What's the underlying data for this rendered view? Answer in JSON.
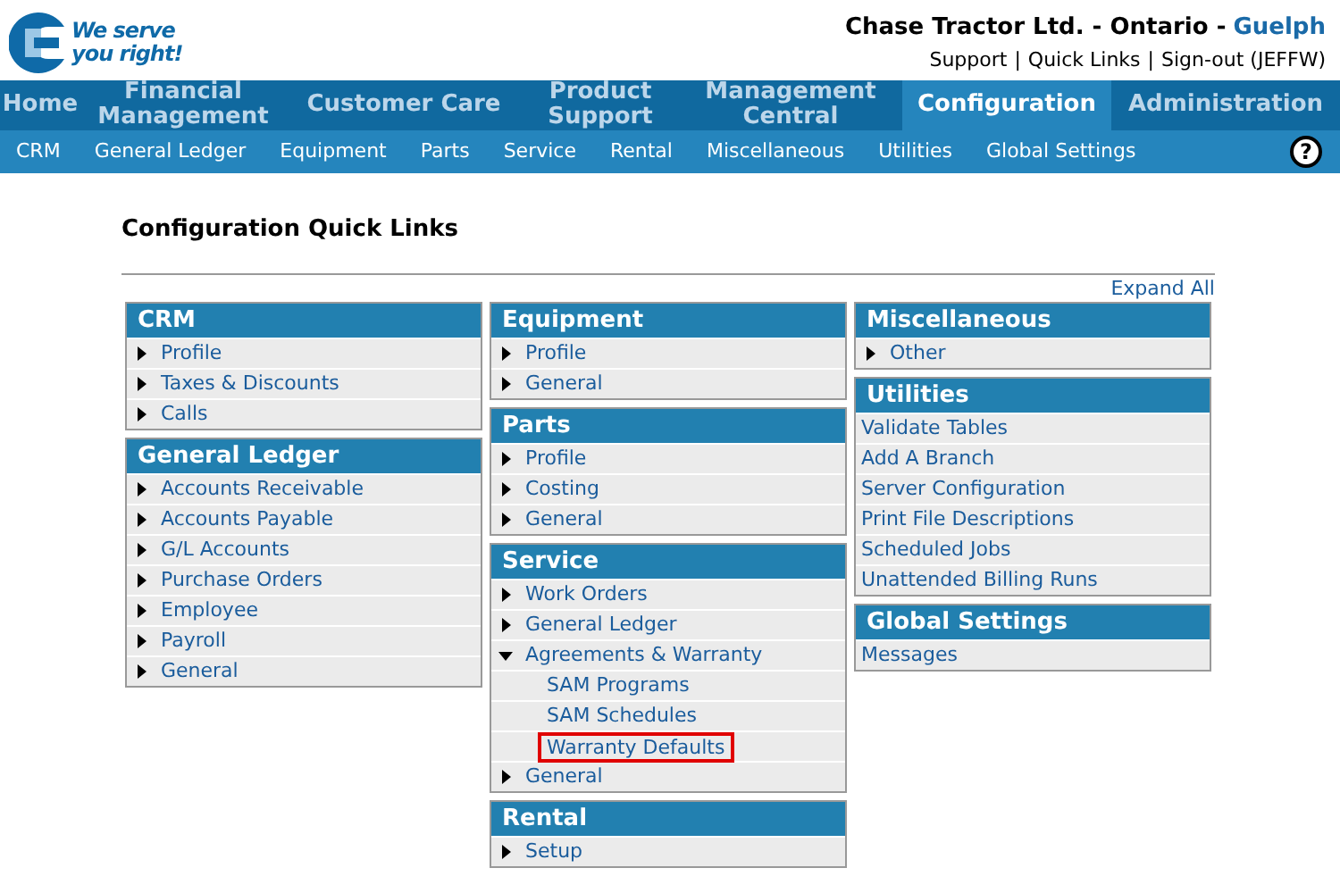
{
  "logo": {
    "tagline": "We serve you right!"
  },
  "header": {
    "company": "Chase Tractor Ltd. - Ontario -",
    "branch": "Guelph",
    "links": [
      "Support",
      "Quick Links",
      "Sign-out (JEFFW)"
    ],
    "separator": "|"
  },
  "main_nav": [
    {
      "label": "Home",
      "selected": false
    },
    {
      "label": "Financial Management",
      "selected": false
    },
    {
      "label": "Customer Care",
      "selected": false
    },
    {
      "label": "Product Support",
      "selected": false
    },
    {
      "label": "Management Central",
      "selected": false
    },
    {
      "label": "Configuration",
      "selected": true
    },
    {
      "label": "Administration",
      "selected": false
    }
  ],
  "sub_nav": [
    "CRM",
    "General Ledger",
    "Equipment",
    "Parts",
    "Service",
    "Rental",
    "Miscellaneous",
    "Utilities",
    "Global Settings"
  ],
  "help": "?",
  "page_title": "Configuration Quick Links",
  "expand_all": "Expand All",
  "columns": [
    [
      {
        "title": "CRM",
        "items": [
          {
            "label": "Profile",
            "kind": "collapsed"
          },
          {
            "label": "Taxes & Discounts",
            "kind": "collapsed"
          },
          {
            "label": "Calls",
            "kind": "collapsed"
          }
        ]
      },
      {
        "title": "General Ledger",
        "items": [
          {
            "label": "Accounts Receivable",
            "kind": "collapsed"
          },
          {
            "label": "Accounts Payable",
            "kind": "collapsed"
          },
          {
            "label": "G/L Accounts",
            "kind": "collapsed"
          },
          {
            "label": "Purchase Orders",
            "kind": "collapsed"
          },
          {
            "label": "Employee",
            "kind": "collapsed"
          },
          {
            "label": "Payroll",
            "kind": "collapsed"
          },
          {
            "label": "General",
            "kind": "collapsed"
          }
        ]
      }
    ],
    [
      {
        "title": "Equipment",
        "items": [
          {
            "label": "Profile",
            "kind": "collapsed"
          },
          {
            "label": "General",
            "kind": "collapsed"
          }
        ]
      },
      {
        "title": "Parts",
        "items": [
          {
            "label": "Profile",
            "kind": "collapsed"
          },
          {
            "label": "Costing",
            "kind": "collapsed"
          },
          {
            "label": "General",
            "kind": "collapsed"
          }
        ]
      },
      {
        "title": "Service",
        "items": [
          {
            "label": "Work Orders",
            "kind": "collapsed"
          },
          {
            "label": "General Ledger",
            "kind": "collapsed"
          },
          {
            "label": "Agreements & Warranty",
            "kind": "expanded",
            "children": [
              {
                "label": "SAM Programs",
                "highlighted": false
              },
              {
                "label": "SAM Schedules",
                "highlighted": false
              },
              {
                "label": "Warranty Defaults",
                "highlighted": true
              }
            ]
          },
          {
            "label": "General",
            "kind": "collapsed"
          }
        ]
      },
      {
        "title": "Rental",
        "items": [
          {
            "label": "Setup",
            "kind": "collapsed"
          }
        ]
      }
    ],
    [
      {
        "title": "Miscellaneous",
        "items": [
          {
            "label": "Other",
            "kind": "collapsed"
          }
        ]
      },
      {
        "title": "Utilities",
        "items": [
          {
            "label": "Validate Tables",
            "kind": "plain"
          },
          {
            "label": "Add A Branch",
            "kind": "plain"
          },
          {
            "label": "Server Configuration",
            "kind": "plain"
          },
          {
            "label": "Print File Descriptions",
            "kind": "plain"
          },
          {
            "label": "Scheduled Jobs",
            "kind": "plain"
          },
          {
            "label": "Unattended Billing Runs",
            "kind": "plain"
          }
        ]
      },
      {
        "title": "Global Settings",
        "items": [
          {
            "label": "Messages",
            "kind": "plain"
          }
        ]
      }
    ]
  ]
}
